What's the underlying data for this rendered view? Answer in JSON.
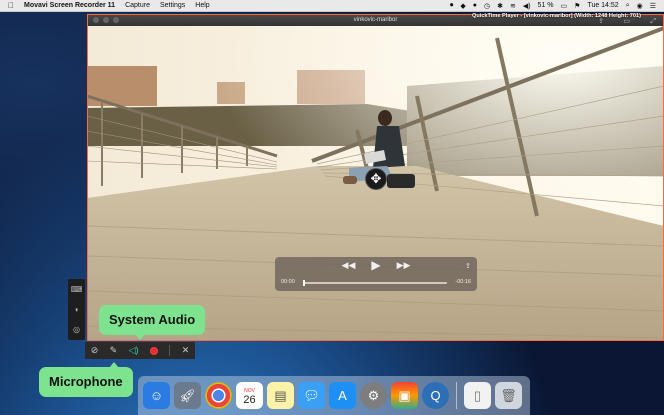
{
  "menubar": {
    "apple": "",
    "app_name": "Movavi Screen Recorder 11",
    "items": [
      "Capture",
      "Settings",
      "Help"
    ],
    "battery": "51 %",
    "clock": "Tue 14:52"
  },
  "quicktime": {
    "window_title": "vinkovic-maribor",
    "time_elapsed": "00:00",
    "time_remaining": "-00:16",
    "progress": 0.0
  },
  "capture_frame": {
    "label": "QuickTime Player - [vinkovic-maribor] (Width: 1248  Height: 701)"
  },
  "callouts": {
    "system_audio": "System Audio",
    "microphone": "Microphone"
  },
  "dock": {
    "calendar_month": "NOV",
    "calendar_day": "26"
  },
  "colors": {
    "capture_border": "#ff6a3d",
    "callout_bg": "#7de38f",
    "audio_on": "#36d2b6",
    "record": "#e23030"
  }
}
